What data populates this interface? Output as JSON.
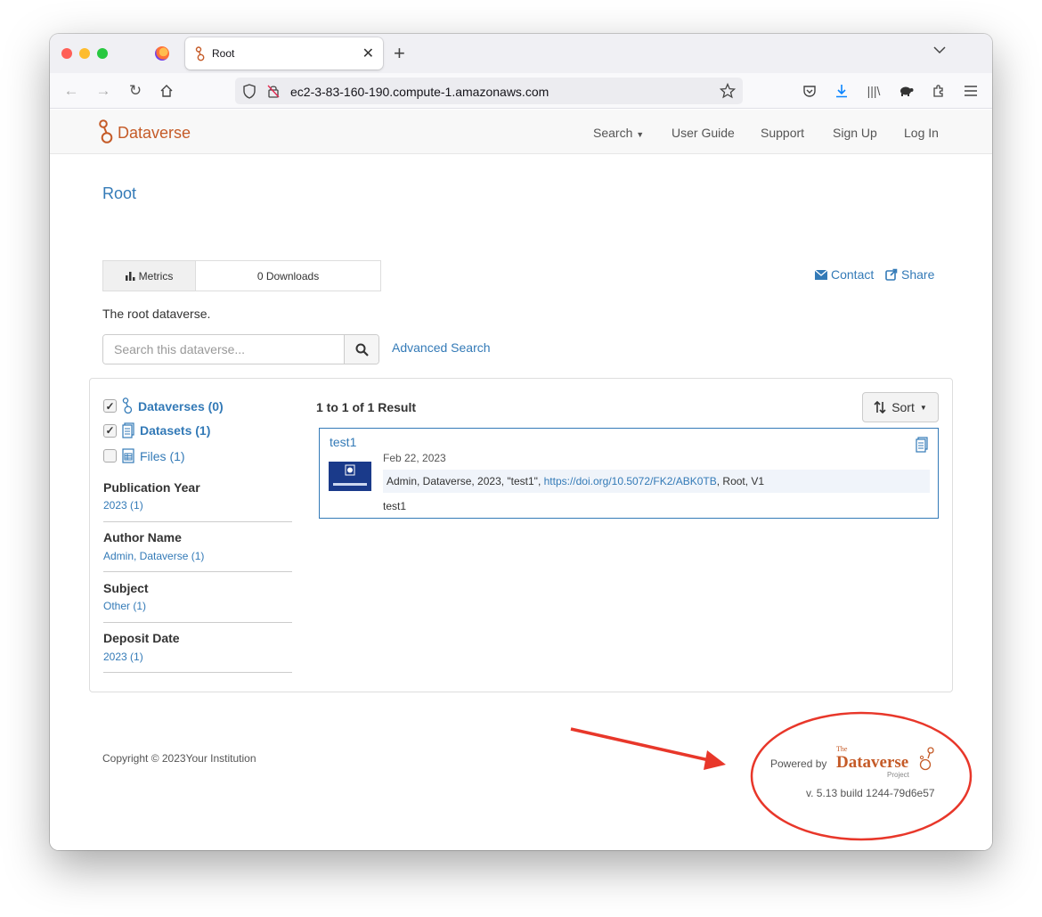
{
  "browser": {
    "tab_title": "Root",
    "url": "ec2-3-83-160-190.compute-1.amazonaws.com"
  },
  "navbar": {
    "brand": "Dataverse",
    "items": [
      "Search",
      "User Guide",
      "Support",
      "Sign Up",
      "Log In"
    ]
  },
  "dataverse": {
    "title": "Root",
    "description": "The root dataverse.",
    "metrics_label": "Metrics",
    "downloads": "0 Downloads",
    "contact_label": "Contact",
    "share_label": "Share"
  },
  "search": {
    "placeholder": "Search this dataverse...",
    "advanced_label": "Advanced Search"
  },
  "facets": {
    "types": [
      {
        "label": "Dataverses (0)",
        "checked": true
      },
      {
        "label": "Datasets (1)",
        "checked": true
      },
      {
        "label": "Files (1)",
        "checked": false
      }
    ],
    "groups": [
      {
        "heading": "Publication Year",
        "value": "2023 (1)"
      },
      {
        "heading": "Author Name",
        "value": "Admin, Dataverse (1)"
      },
      {
        "heading": "Subject",
        "value": "Other (1)"
      },
      {
        "heading": "Deposit Date",
        "value": "2023 (1)"
      }
    ]
  },
  "results": {
    "count_text": "1 to 1 of 1 Result",
    "sort_label": "Sort",
    "item": {
      "title": "test1",
      "date": "Feb 22, 2023",
      "citation_prefix": "Admin, Dataverse, 2023, \"test1\", ",
      "doi": "https://doi.org/10.5072/FK2/ABK0TB",
      "citation_suffix": ", Root, V1",
      "description": "test1"
    }
  },
  "footer": {
    "copyright": "Copyright © 2023Your Institution",
    "powered_by": "Powered by",
    "version": "v. 5.13 build 1244-79d6e57",
    "logo_the": "The",
    "logo_name": "Dataverse",
    "logo_project": "Project"
  },
  "colors": {
    "brand": "#c55b28",
    "link": "#337ab7",
    "annotation": "#e8372a"
  }
}
